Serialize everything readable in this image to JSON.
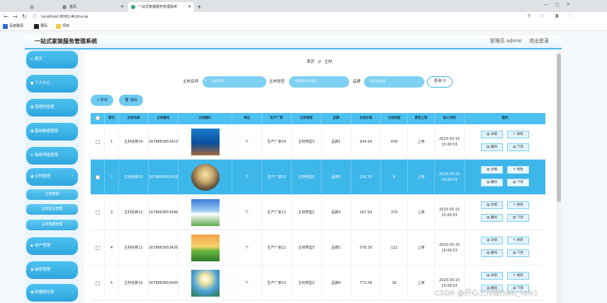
{
  "browser": {
    "tabs": [
      {
        "label": ""
      },
      {
        "label": "首页"
      },
      {
        "label": "一站式家装服务管理系统"
      }
    ],
    "new_tab": "+",
    "url": "localhost:8081/#/zhucai",
    "bookmarks": [
      "百度翻译",
      "要码",
      "项目"
    ],
    "window_controls": [
      "—",
      "□",
      "✕"
    ]
  },
  "header": {
    "title": "一站式家装服务管理系统",
    "user": "管理员 admin",
    "logout": "退出登录"
  },
  "sidebar": {
    "items": [
      {
        "label": "首页",
        "icon": "home-icon"
      },
      {
        "label": "个人中心",
        "icon": "user-icon"
      },
      {
        "label": "管理员管理",
        "icon": "grid-icon"
      },
      {
        "label": "基础数据管理",
        "icon": "grid-icon"
      },
      {
        "label": "装修风格管理",
        "icon": "send-icon"
      },
      {
        "label": "主材管理",
        "icon": "grid-icon"
      },
      {
        "label": "用户管理",
        "icon": "user-group-icon"
      },
      {
        "label": "装修管理",
        "icon": "grid-icon"
      },
      {
        "label": "轮播图信息",
        "icon": "grid-icon"
      }
    ],
    "sub_items": [
      "主材管理",
      "主材留言管理",
      "主材收藏管理"
    ]
  },
  "breadcrumb": {
    "home": "首页",
    "sep": "//",
    "current": "主材"
  },
  "search": {
    "name_label": "主材名称",
    "name_placeholder": "主材名称",
    "type_label": "主材类型",
    "type_placeholder": "请选择主材类型",
    "brand_label": "品牌",
    "brand_placeholder": "请选择品牌",
    "query_button": "查询"
  },
  "actions": {
    "add": "新增",
    "delete": "删除"
  },
  "table": {
    "headers": [
      "索引",
      "主材名称",
      "主材编号",
      "主材图片",
      "单位",
      "生产厂家",
      "主材类型",
      "品牌",
      "主材价格",
      "主材热度",
      "是否上架",
      "录入时间",
      "操作"
    ],
    "op_labels": {
      "detail": "详情",
      "edit": "修改",
      "delete": "删除",
      "offshelf": "下架"
    },
    "rows": [
      {
        "index": "1",
        "name": "主材名称14",
        "code": "1678863653423",
        "unit": "个",
        "maker": "生产厂家14",
        "type": "主材类型3",
        "brand": "品牌1",
        "price": "934.94",
        "heat": "439",
        "status": "上架",
        "time": "2023-03-15 15:00:53",
        "pic": "pic-1"
      },
      {
        "index": "2",
        "name": "主材名称13",
        "code": "1678863653428",
        "unit": "个",
        "maker": "生产厂家13",
        "type": "主材类型2",
        "brand": "品牌2",
        "price": "116.25",
        "heat": "8",
        "status": "上架",
        "time": "2023-03-15 15:00:53",
        "pic": "pic-2"
      },
      {
        "index": "3",
        "name": "主材名称12",
        "code": "1678863653496",
        "unit": "个",
        "maker": "生产厂家12",
        "type": "主材类型2",
        "brand": "品牌3",
        "price": "167.93",
        "heat": "379",
        "status": "上架",
        "time": "2023-03-15 15:00:53",
        "pic": "pic-3"
      },
      {
        "index": "4",
        "name": "主材名称11",
        "code": "1678863653426",
        "unit": "个",
        "maker": "生产厂家11",
        "type": "主材类型3",
        "brand": "品牌2",
        "price": "578.39",
        "heat": "122",
        "status": "上架",
        "time": "2023-03-15 15:00:53",
        "pic": "pic-4"
      },
      {
        "index": "5",
        "name": "主材名称10",
        "code": "1678863653400",
        "unit": "个",
        "maker": "生产厂家10",
        "type": "主材类型2",
        "brand": "品牌4",
        "price": "772.58",
        "heat": "28",
        "status": "上架",
        "time": "2023-03-15 15:00:53",
        "pic": "pic-5"
      }
    ]
  },
  "watermark": "CSDN @开心工作室(kaic_kaic)",
  "colors": {
    "accent": "#3db6ea",
    "menu": "#39aee2",
    "header_bg": "#dee1e6"
  }
}
